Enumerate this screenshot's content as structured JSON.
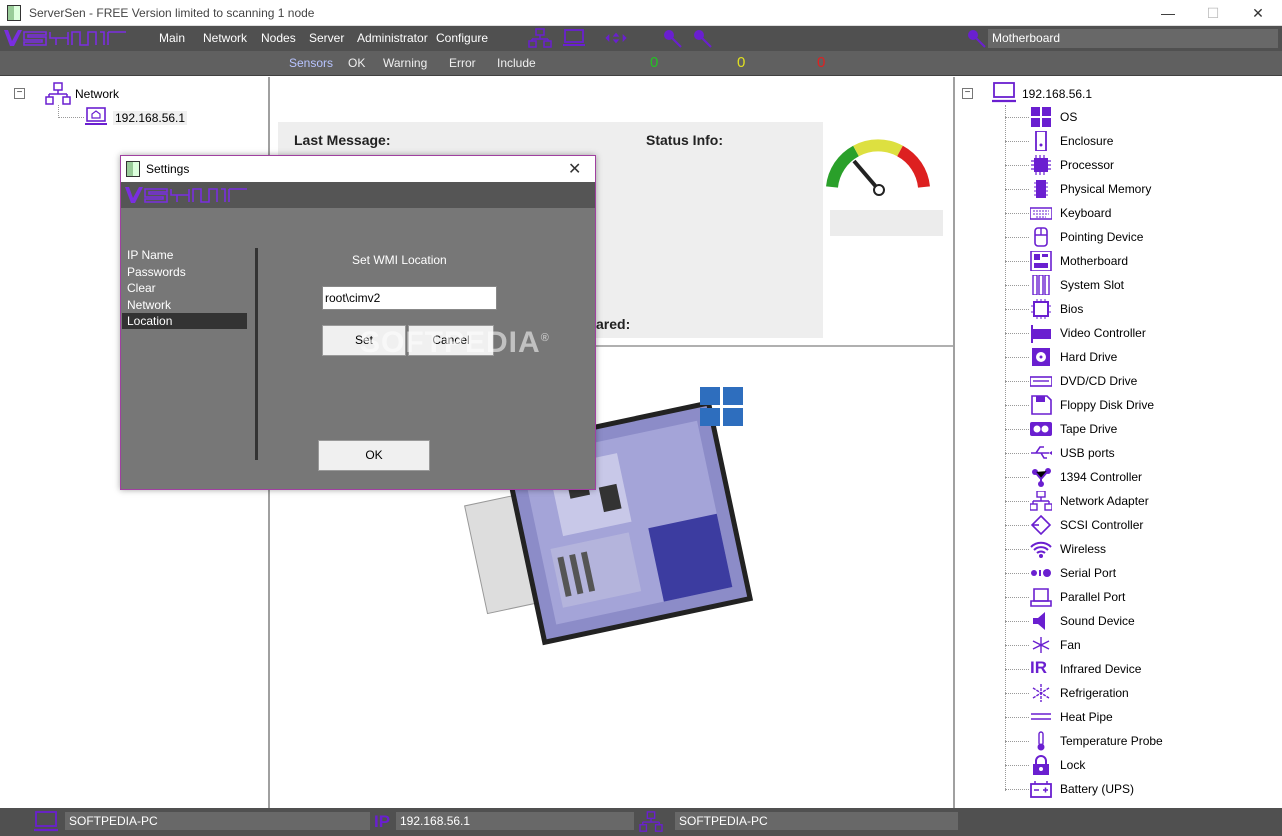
{
  "window": {
    "title": "ServerSen - FREE Version limited to scanning 1 node",
    "min_glyph": "—",
    "max_glyph": "☐",
    "close_glyph": "✕"
  },
  "menu": [
    "Main",
    "Network",
    "Nodes",
    "Server",
    "Administrator",
    "Configure"
  ],
  "selected_item_field": "Motherboard",
  "sensors": {
    "tabs": [
      "Sensors",
      "OK",
      "Warning",
      "Error",
      "Include"
    ],
    "active": "Sensors",
    "counts": [
      {
        "value": "0",
        "color": "#22c322"
      },
      {
        "value": "0",
        "color": "#e0e020"
      },
      {
        "value": "0",
        "color": "#e02020"
      }
    ]
  },
  "left_tree": {
    "root": "Network",
    "expander": "−",
    "children": [
      "192.168.56.1"
    ]
  },
  "center": {
    "last_message_label": "Last Message:",
    "status_info_label": "Status Info:",
    "partial_label": "ared:"
  },
  "right_tree": {
    "root": "192.168.56.1",
    "expander": "−",
    "items": [
      {
        "label": "OS",
        "icon": "windows-icon"
      },
      {
        "label": "Enclosure",
        "icon": "enclosure-icon"
      },
      {
        "label": "Processor",
        "icon": "processor-icon"
      },
      {
        "label": "Physical Memory",
        "icon": "memory-icon"
      },
      {
        "label": "Keyboard",
        "icon": "keyboard-icon"
      },
      {
        "label": "Pointing Device",
        "icon": "mouse-icon"
      },
      {
        "label": "Motherboard",
        "icon": "motherboard-icon"
      },
      {
        "label": "System Slot",
        "icon": "system-slot-icon"
      },
      {
        "label": "Bios",
        "icon": "bios-chip-icon"
      },
      {
        "label": "Video Controller",
        "icon": "video-card-icon"
      },
      {
        "label": "Hard Drive",
        "icon": "hard-drive-icon"
      },
      {
        "label": "DVD/CD Drive",
        "icon": "dvd-drive-icon"
      },
      {
        "label": "Floppy Disk Drive",
        "icon": "floppy-icon"
      },
      {
        "label": "Tape Drive",
        "icon": "tape-drive-icon"
      },
      {
        "label": "USB ports",
        "icon": "usb-icon"
      },
      {
        "label": "1394 Controller",
        "icon": "firewire-icon"
      },
      {
        "label": "Network Adapter",
        "icon": "network-adapter-icon"
      },
      {
        "label": "SCSI Controller",
        "icon": "scsi-icon"
      },
      {
        "label": "Wireless",
        "icon": "wireless-icon"
      },
      {
        "label": "Serial Port",
        "icon": "serial-port-icon"
      },
      {
        "label": "Parallel Port",
        "icon": "parallel-port-icon"
      },
      {
        "label": "Sound Device",
        "icon": "speaker-icon"
      },
      {
        "label": "Fan",
        "icon": "fan-icon"
      },
      {
        "label": "Infrared Device",
        "icon": "infrared-icon",
        "glyph": "IR"
      },
      {
        "label": "Refrigeration",
        "icon": "snowflake-icon"
      },
      {
        "label": "Heat Pipe",
        "icon": "heat-pipe-icon"
      },
      {
        "label": "Temperature Probe",
        "icon": "thermometer-icon"
      },
      {
        "label": "Lock",
        "icon": "lock-icon"
      },
      {
        "label": "Battery (UPS)",
        "icon": "battery-icon"
      }
    ]
  },
  "status_bar": {
    "computer": "SOFTPEDIA-PC",
    "ip_glyph": "IP",
    "ip": "192.168.56.1",
    "network_computer": "SOFTPEDIA-PC"
  },
  "dialog": {
    "title": "Settings",
    "close_glyph": "✕",
    "nav": [
      "IP Name",
      "Passwords",
      "Clear",
      "Network",
      "Location"
    ],
    "selected_nav": "Location",
    "caption": "Set WMI Location",
    "input_value": "root\\cimv2",
    "set_label": "Set",
    "cancel_label": "Cancel",
    "ok_label": "OK"
  },
  "watermark": "SOFTPEDIA",
  "watermark_mark": "®",
  "colors": {
    "accent": "#6a1fd0",
    "toolbar": "#505050",
    "dialog_border": "#a040a0"
  }
}
